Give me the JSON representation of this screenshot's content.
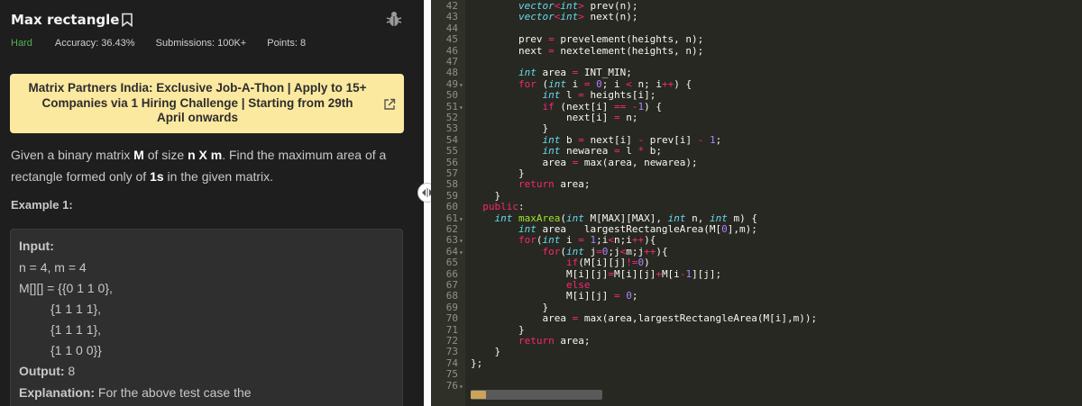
{
  "problem": {
    "title": "Max rectangle",
    "difficulty": "Hard",
    "accuracy": "Accuracy: 36.43%",
    "submissions": "Submissions: 100K+",
    "points": "Points: 8"
  },
  "banner": {
    "text": "Matrix Partners India: Exclusive Job-A-Thon | Apply to 15+ Companies via 1 Hiring Challenge | Starting from 29th April onwards"
  },
  "description": {
    "part1": "Given a binary matrix ",
    "M": "M",
    "part2": " of size ",
    "size": "n X m",
    "part3": ". Find the maximum area of a rectangle formed only of ",
    "ones": "1s",
    "part4": " in the given matrix."
  },
  "example": {
    "title": "Example 1:",
    "input_label": "Input:",
    "lines": [
      "n = 4, m = 4",
      "M[][] = {{0 1 1 0},",
      "         {1 1 1 1},",
      "         {1 1 1 1},",
      "         {1 1 0 0}}"
    ],
    "output_label": "Output:",
    "output_value": "8",
    "explanation_label": "Explanation:",
    "explanation_text": "For the above test case the"
  },
  "editor": {
    "line_numbers": [
      "42",
      "43",
      "44",
      "45",
      "46",
      "47",
      "48",
      "49",
      "50",
      "51",
      "52",
      "53",
      "54",
      "55",
      "56",
      "57",
      "58",
      "59",
      "60",
      "61",
      "62",
      "63",
      "64",
      "65",
      "66",
      "67",
      "68",
      "69",
      "70",
      "71",
      "72",
      "73",
      "74",
      "75",
      "76"
    ],
    "fold_lines": [
      "49",
      "51",
      "61",
      "63",
      "64",
      "76"
    ],
    "code": [
      "        vector<int> prev(n);",
      "        vector<int> next(n);",
      "",
      "        prev = prevelement(heights, n);",
      "        next = nextelement(heights, n);",
      "",
      "        int area = INT_MIN;",
      "        for (int i = 0; i < n; i++) {",
      "            int l = heights[i];",
      "            if (next[i] == -1) {",
      "                next[i] = n;",
      "            }",
      "            int b = next[i] - prev[i] - 1;",
      "            int newarea = l * b;",
      "            area = max(area, newarea);",
      "        }",
      "        return area;",
      "    }",
      "  public:",
      "    int maxArea(int M[MAX][MAX], int n, int m) {",
      "        int area   largestRectangleArea(M[0],m);",
      "        for(int i = 1;i<n;i++){",
      "            for(int j=0;j<m;j++){",
      "                if(M[i][j]!=0)",
      "                M[i][j]=M[i][j]+M[i-1][j];",
      "                else",
      "                M[i][j] = 0;",
      "            }",
      "            area = max(area,largestRectangleArea(M[i],m));",
      "        }",
      "        return area;",
      "    }",
      "};",
      "",
      ""
    ]
  },
  "colors": {
    "difficulty": "#52b352",
    "banner_bg": "#fbe9a0",
    "editor_bg": "#272822"
  },
  "icons": [
    "bookmark-icon",
    "bug-icon",
    "external-link-icon",
    "resize-handle-icon"
  ]
}
